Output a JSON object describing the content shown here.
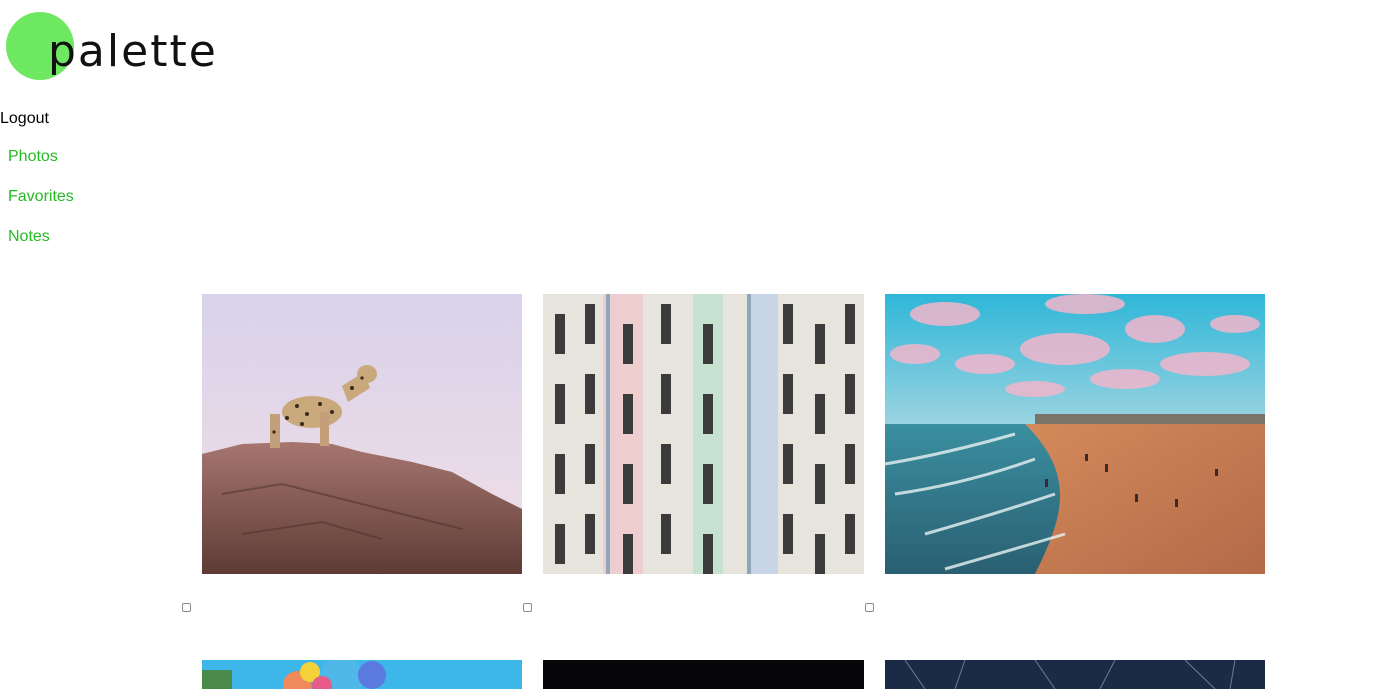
{
  "app": {
    "logo_text": "palette",
    "brand_color": "#6ee860",
    "link_color": "#22bb22"
  },
  "header": {
    "logout_label": "Logout"
  },
  "nav": {
    "items": [
      {
        "label": "Photos"
      },
      {
        "label": "Favorites"
      },
      {
        "label": "Notes"
      }
    ]
  },
  "photos": [
    {
      "subject": "leopard-on-rock",
      "selected": false
    },
    {
      "subject": "pastel-building-facade",
      "selected": false
    },
    {
      "subject": "beach-sunset",
      "selected": false
    },
    {
      "subject": "balloons"
    },
    {
      "subject": "dark-photo"
    },
    {
      "subject": "starry-night"
    }
  ]
}
